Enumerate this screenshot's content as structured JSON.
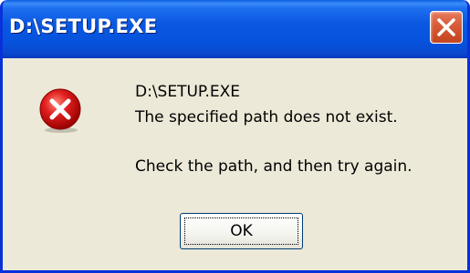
{
  "window": {
    "title": "D:\\SETUP.EXE",
    "close_icon": "close-icon"
  },
  "message": {
    "icon": "error-icon",
    "line1": "D:\\SETUP.EXE",
    "line2": "The specified path does not exist.",
    "line3": "Check the path, and then try again."
  },
  "buttons": {
    "ok_label": "OK"
  },
  "colors": {
    "titlebar": "#0a58e0",
    "dialog_bg": "#ece9d8",
    "close_button": "#d65a36",
    "error_red": "#e01f1f"
  }
}
